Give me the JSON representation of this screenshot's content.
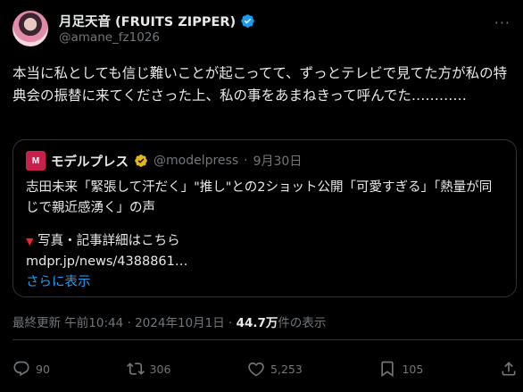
{
  "author": {
    "display_name": "月足天音 (FRUITS ZIPPER)",
    "handle": "@amane_fz1026"
  },
  "tweet": {
    "text": "本当に私としても信じ難いことが起こってて、ずっとテレビで見てた方が私の特典会の振替に来てくださった上、私の事をあまねきって呼んでた…………"
  },
  "quote": {
    "logo_text": "M",
    "name": "モデルプレス",
    "handle": "@modelpress",
    "separator": "·",
    "date": "9月30日",
    "line1": "志田未来「緊張して汗だく」\"推し\"との2ショット公開「可愛すぎる」「熱量が同じで親近感湧く」の声",
    "detail_triangle": "▼",
    "detail_label": "写真・記事詳細はこちら",
    "link": "mdpr.jp/news/4388861…",
    "show_more": "さらに表示"
  },
  "meta": {
    "updated_label": "最終更新",
    "time": "午前10:44",
    "dot1": "·",
    "date": "2024年10月1日",
    "dot2": "·",
    "views": "44.7万",
    "views_label": "件の表示"
  },
  "actions": {
    "replies": "90",
    "reposts": "306",
    "likes": "5,253",
    "bookmarks": "105"
  },
  "colors": {
    "background": "#000000",
    "text": "#e7e9ea",
    "muted": "#71767b",
    "accent": "#1d9bf0",
    "verified_gold": "#e2b719",
    "border": "#2f3336"
  },
  "icons": {
    "verified": "verified-badge-icon",
    "quote_verified": "gold-verified-badge-icon",
    "more": "more-options-icon",
    "reply": "reply-icon",
    "repost": "repost-icon",
    "like": "heart-icon",
    "bookmark": "bookmark-icon",
    "share": "share-icon"
  }
}
